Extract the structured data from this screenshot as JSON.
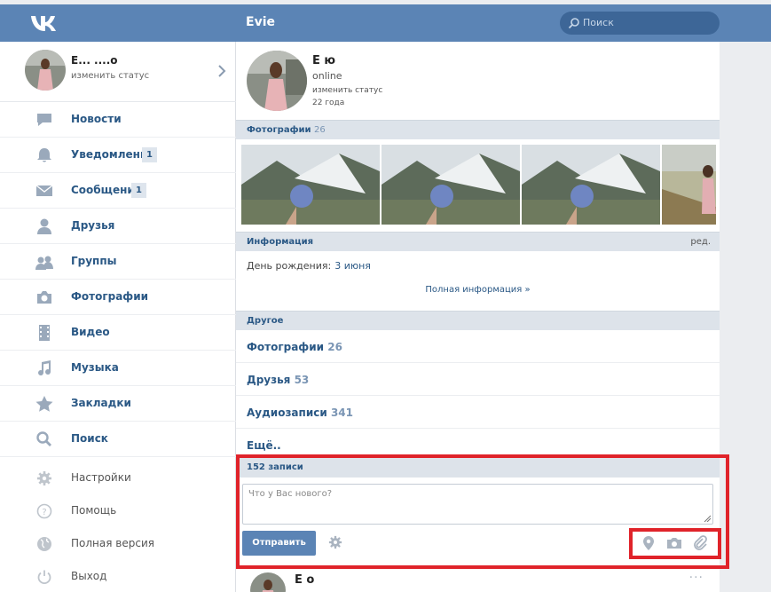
{
  "header": {
    "title": "Evie",
    "search_placeholder": "Поиск"
  },
  "sidebar": {
    "profile": {
      "name": "E... ....o",
      "status": "изменить статус"
    },
    "items": [
      {
        "label": "Новости",
        "icon": "news-icon"
      },
      {
        "label": "Уведомления",
        "icon": "bell-icon",
        "badge": "1"
      },
      {
        "label": "Сообщения",
        "icon": "envelope-icon",
        "badge": "1"
      },
      {
        "label": "Друзья",
        "icon": "user-icon"
      },
      {
        "label": "Группы",
        "icon": "users-icon"
      },
      {
        "label": "Фотографии",
        "icon": "camera-icon"
      },
      {
        "label": "Видео",
        "icon": "film-icon"
      },
      {
        "label": "Музыка",
        "icon": "music-icon"
      },
      {
        "label": "Закладки",
        "icon": "star-icon"
      },
      {
        "label": "Поиск",
        "icon": "search-icon"
      }
    ],
    "secondary": [
      {
        "label": "Настройки",
        "icon": "gear-icon"
      },
      {
        "label": "Помощь",
        "icon": "help-icon"
      },
      {
        "label": "Полная версия",
        "icon": "globe-icon"
      },
      {
        "label": "Выход",
        "icon": "power-icon"
      }
    ]
  },
  "profile": {
    "name": "E                ю",
    "online": "online",
    "status": "изменить статус",
    "age": "22 года"
  },
  "photos": {
    "label": "Фотографии",
    "count": "26"
  },
  "info": {
    "label": "Информация",
    "edit": "ред.",
    "birthday_label": "День рождения:",
    "birthday_value": "3 июня",
    "full_info": "Полная информация »"
  },
  "other": {
    "label": "Другое",
    "rows": [
      {
        "label": "Фотографии",
        "count": "26"
      },
      {
        "label": "Друзья",
        "count": "53"
      },
      {
        "label": "Аудиозаписи",
        "count": "341"
      },
      {
        "label": "Ещё..",
        "count": ""
      }
    ]
  },
  "wall": {
    "count_label": "152 записи",
    "placeholder": "Что у Вас нового?",
    "send_label": "Отправить"
  },
  "next_post": {
    "name": "E                o",
    "menu": "···"
  },
  "colors": {
    "header": "#5b84b5",
    "link": "#2a5885",
    "highlight": "#e0232a"
  }
}
